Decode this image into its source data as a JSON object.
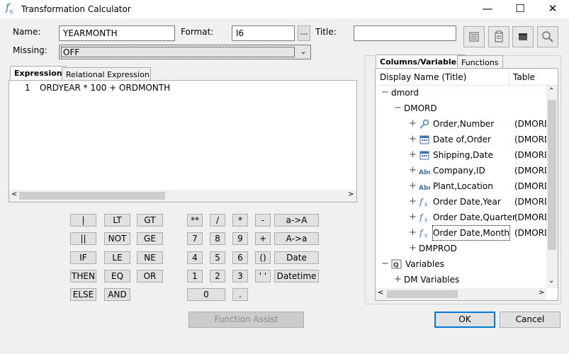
{
  "window": {
    "title": "Transformation Calculator",
    "icon": "fx-icon"
  },
  "controls": {
    "minimize": "—",
    "maximize": "☐",
    "close": "✕"
  },
  "form": {
    "name_label": "Name:",
    "name_value": "YEARMONTH",
    "format_label": "Format:",
    "format_value": "I6",
    "format_button": "...",
    "title_label": "Title:",
    "title_value": "",
    "missing_label": "Missing:",
    "missing_value": "OFF"
  },
  "left_tabs": [
    "Expression",
    "Relational Expression"
  ],
  "editor": {
    "line_number": "1",
    "code": "ORDYEAR * 100 +  ORDMONTH"
  },
  "keypad": {
    "col1": [
      "|",
      "||",
      "IF",
      "THEN",
      "ELSE"
    ],
    "col2": [
      "LT",
      "NOT",
      "LE",
      "EQ",
      "AND"
    ],
    "col3": [
      "GT",
      "GE",
      "NE",
      "OR"
    ],
    "nums": [
      [
        "**",
        "/",
        "*",
        "-"
      ],
      [
        "7",
        "8",
        "9",
        "+"
      ],
      [
        "4",
        "5",
        "6",
        "()"
      ],
      [
        "1",
        "2",
        "3",
        "' '"
      ]
    ],
    "zero": "0",
    "dot": ".",
    "right": [
      "a->A",
      "A->a",
      "Date",
      "Datetime"
    ]
  },
  "function_assist": "Function Assist",
  "right_tabs": [
    "Columns/Variables",
    "Functions"
  ],
  "tree": {
    "headers": [
      "Display Name (Title)",
      "Table"
    ],
    "rows": [
      {
        "pm": "−",
        "label": "dmord",
        "table": "",
        "icon": ""
      },
      {
        "pm": "−",
        "label": "DMORD",
        "table": "",
        "icon": ""
      },
      {
        "pm": "+",
        "label": "Order,Number",
        "table": "(DMORD",
        "icon": "key-icon"
      },
      {
        "pm": "+",
        "label": "Date of,Order",
        "table": "(DMORD",
        "icon": "calendar-icon"
      },
      {
        "pm": "+",
        "label": "Shipping,Date",
        "table": "(DMORD",
        "icon": "calendar-icon"
      },
      {
        "pm": "+",
        "label": "Company,ID",
        "table": "(DMORD",
        "icon": "abc-icon"
      },
      {
        "pm": "+",
        "label": "Plant,Location",
        "table": "(DMORD",
        "icon": "abc-icon"
      },
      {
        "pm": "+",
        "label": "Order Date,Year",
        "table": "(DMORD",
        "icon": "fx-icon"
      },
      {
        "pm": "+",
        "label": "Order Date,Quarter",
        "table": "(DMORD",
        "icon": "fx-icon"
      },
      {
        "pm": "+",
        "label": "Order Date,Month",
        "table": "(DMORD",
        "icon": "fx-icon"
      },
      {
        "pm": "+",
        "label": "DMPROD",
        "table": "",
        "icon": ""
      },
      {
        "pm": "−",
        "label": "Variables",
        "table": "",
        "icon": "variables-icon"
      },
      {
        "pm": "+",
        "label": "DM Variables",
        "table": "",
        "icon": ""
      }
    ]
  },
  "ok_label": "OK",
  "cancel_label": "Cancel",
  "colors": {
    "accent": "#0078d7",
    "icon_blue": "#3b6fb6"
  }
}
